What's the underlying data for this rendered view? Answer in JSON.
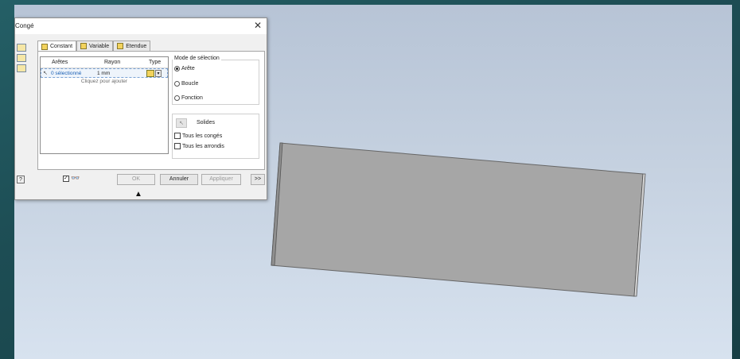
{
  "dialog": {
    "title": "Congé",
    "close_glyph": "✕",
    "tabs": [
      {
        "label": "Constant",
        "icon": "constant-fillet-icon"
      },
      {
        "label": "Variable",
        "icon": "variable-fillet-icon"
      },
      {
        "label": "Etendue",
        "icon": "setback-fillet-icon"
      }
    ],
    "table": {
      "headers": [
        "Arêtes",
        "Rayon",
        "Type"
      ],
      "rows": [
        {
          "edges": "0 sélectionné",
          "radius": "1 mm"
        }
      ],
      "add_placeholder": "Cliquez pour ajouter"
    },
    "selection_mode": {
      "title": "Mode de sélection",
      "options": [
        "Arête",
        "Boucle",
        "Fonction"
      ],
      "selected": "Arête"
    },
    "solids": {
      "label": "Solides",
      "all_fillets": "Tous les congés",
      "all_rounds": "Tous les arrondis"
    },
    "buttons": {
      "ok": "OK",
      "cancel": "Annuler",
      "apply": "Appliquer",
      "more": ">>"
    },
    "help_glyph": "?",
    "glasses_glyph": "👓",
    "arrow_glyph": "▲"
  },
  "colors": {
    "part_face": "#a6a6a6",
    "part_edge": "#595959"
  }
}
